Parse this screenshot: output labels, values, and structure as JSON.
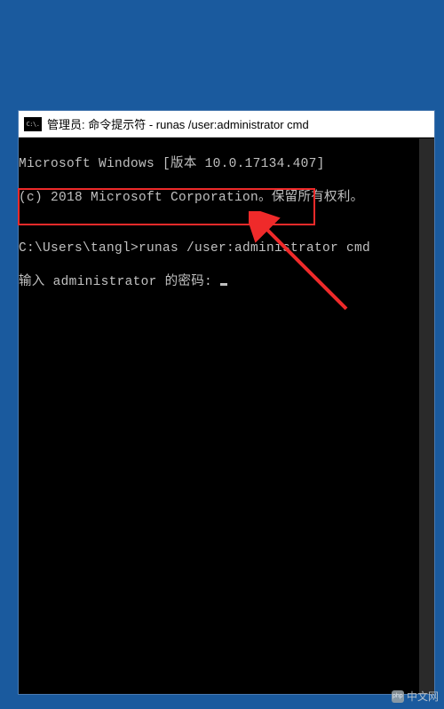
{
  "titlebar": {
    "icon_label": "C:\\.",
    "title": "管理员: 命令提示符 - runas  /user:administrator cmd"
  },
  "console": {
    "line1": "Microsoft Windows [版本 10.0.17134.407]",
    "line2": "(c) 2018 Microsoft Corporation。保留所有权利。",
    "line3": "",
    "line4": "C:\\Users\\tangl>runas /user:administrator cmd",
    "line5_prefix": "输入 administrator 的密码: "
  },
  "watermark": {
    "text": "中文网"
  },
  "annotation": {
    "highlight_color": "#ef2a2a",
    "arrow_color": "#ef2a2a"
  }
}
